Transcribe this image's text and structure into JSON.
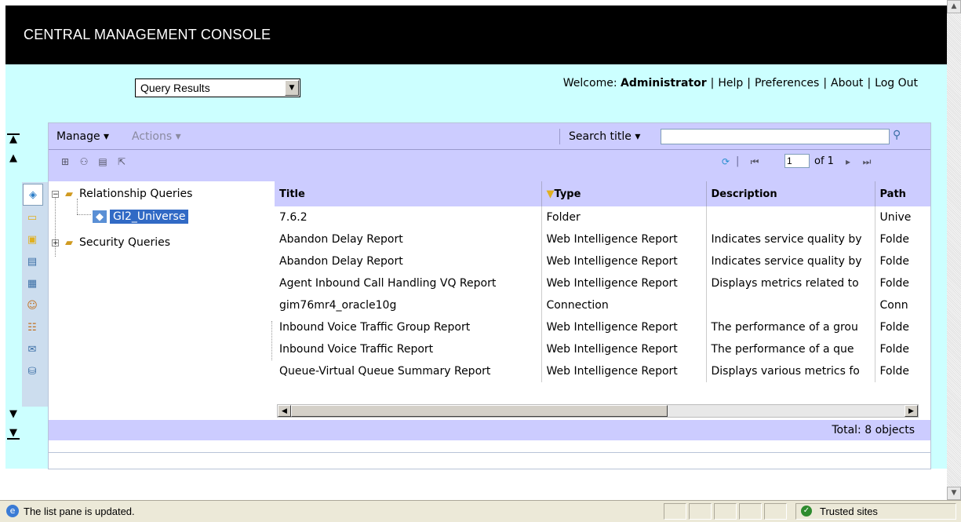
{
  "banner": {
    "title": "CENTRAL MANAGEMENT CONSOLE"
  },
  "page_select": {
    "value": "Query Results"
  },
  "welcome": {
    "prefix": "Welcome:",
    "user": "Administrator",
    "links": [
      "Help",
      "Preferences",
      "About",
      "Log Out"
    ],
    "separator": "|"
  },
  "toolbar": {
    "manage": "Manage ▾",
    "actions": "Actions ▾",
    "search_label": "Search title ▾",
    "search_value": "",
    "page_value": "1",
    "page_of": "of 1"
  },
  "tree": {
    "nodes": [
      {
        "label": "Relationship Queries",
        "icon": "relationship-queries-icon",
        "expanded": true
      },
      {
        "label": "GI2_Universe",
        "icon": "universe-query-icon",
        "selected": true
      },
      {
        "label": "Security Queries",
        "icon": "security-queries-icon",
        "expanded": false
      }
    ]
  },
  "table": {
    "columns": [
      "Title",
      "Type",
      "Description",
      "Path"
    ],
    "rows": [
      [
        "7.6.2",
        "Folder",
        "",
        "Unive"
      ],
      [
        "Abandon Delay Report",
        "Web Intelligence Report",
        "Indicates service quality by",
        "Folde"
      ],
      [
        "Abandon Delay Report",
        "Web Intelligence Report",
        "Indicates service quality by",
        "Folde"
      ],
      [
        "Agent Inbound Call Handling VQ Report",
        "Web Intelligence Report",
        "Displays metrics related to",
        "Folde"
      ],
      [
        "gim76mr4_oracle10g",
        "Connection",
        "",
        "Conn"
      ],
      [
        "Inbound Voice Traffic Group Report",
        "Web Intelligence Report",
        "The performance of a grou",
        "Folde"
      ],
      [
        "Inbound Voice Traffic Report",
        "Web Intelligence Report",
        "The performance of a que",
        "Folde"
      ],
      [
        "Queue-Virtual Queue Summary Report",
        "Web Intelligence Report",
        "Displays various metrics fo",
        "Folde"
      ]
    ]
  },
  "footer": {
    "total": "Total: 8 objects"
  },
  "status": {
    "message": "The list pane is updated.",
    "zone": "Trusted sites"
  }
}
